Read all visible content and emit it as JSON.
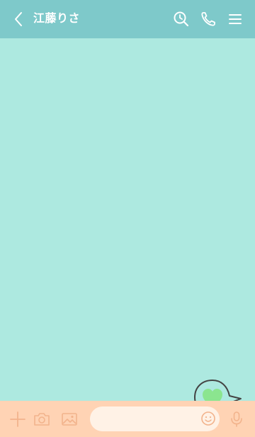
{
  "header": {
    "title": "江藤りさ",
    "icons": [
      "back-arrow-icon",
      "search-clock-icon",
      "phone-icon",
      "hamburger-menu-icon"
    ],
    "background": "#7ec9ca",
    "text_color": "#ffffff"
  },
  "chat": {
    "background": "#ade9e0",
    "sticker": {
      "type": "heart-speech-bubble",
      "heart_color": "#8be58f",
      "outline_color": "#444444"
    }
  },
  "input_bar": {
    "background": "#ffd3b4",
    "icon_color": "#f2b38c",
    "field_value": "",
    "field_placeholder": "",
    "field_background": "#fff2e6",
    "icons": [
      "plus-icon",
      "camera-icon",
      "image-icon",
      "emoji-icon",
      "microphone-icon"
    ]
  }
}
